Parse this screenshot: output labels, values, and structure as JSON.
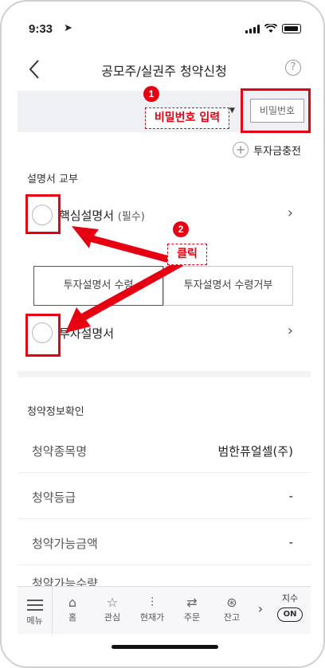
{
  "status_bar": {
    "time": "9:33",
    "location_arrow": "location-arrow-icon"
  },
  "header": {
    "title": "공모주/실권주 청약신청",
    "help_label": "?"
  },
  "password": {
    "placeholder": "비밀번호"
  },
  "annotation_1": {
    "number": "1",
    "text": "비밀번호 입력"
  },
  "annotation_2": {
    "number": "2",
    "text": "클릭"
  },
  "charge_label": "투자금충전",
  "prospectus": {
    "section_label": "설명서 교부",
    "core_label": "핵심설명서",
    "core_required": "(필수)",
    "receive_label": "투자설명서 수령",
    "refuse_label": "투자설명서 수령거부",
    "investment_label": "투자설명서"
  },
  "subscription_info": {
    "section_label": "청약정보확인",
    "rows": [
      {
        "label": "청약종목명",
        "value": "범한퓨얼셀(주)"
      },
      {
        "label": "청약등급",
        "value": "-"
      },
      {
        "label": "청약가능금액",
        "value": "-"
      }
    ],
    "partial_label": "청약가능수량"
  },
  "tabbar": {
    "menu_label": "메뉴",
    "tabs": [
      {
        "label": "홈",
        "icon": "home-icon"
      },
      {
        "label": "관심",
        "icon": "star-icon"
      },
      {
        "label": "현재가",
        "icon": "equalizer-icon"
      },
      {
        "label": "주문",
        "icon": "swap-icon"
      },
      {
        "label": "잔고",
        "icon": "balance-icon"
      }
    ],
    "next_label": "›",
    "index_label": "지수",
    "index_toggle": "ON"
  },
  "colors": {
    "accent_red": "#e60012",
    "band_bg": "#eef0f4"
  }
}
